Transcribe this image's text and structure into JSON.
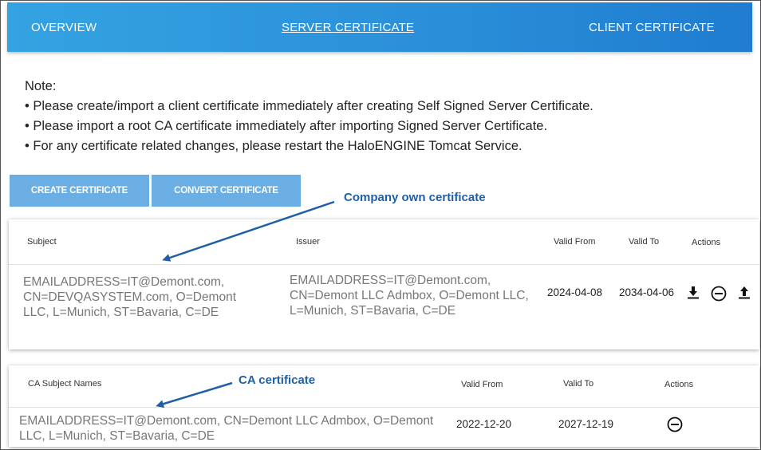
{
  "tabs": {
    "overview": "OVERVIEW",
    "server_certificate": "SERVER CERTIFICATE",
    "client_certificate": "CLIENT CERTIFICATE",
    "active": "server_certificate"
  },
  "note": {
    "heading": "Note:",
    "lines": [
      "• Please create/import a client certificate immediately after creating Self Signed Server Certificate.",
      "• Please import a root CA certificate immediately after importing Signed Server Certificate.",
      "• For any certificate related changes, please restart the HaloENGINE Tomcat Service."
    ]
  },
  "buttons": {
    "create": "CREATE CERTIFICATE",
    "convert": "CONVERT CERTIFICATE"
  },
  "annotations": {
    "company_own": "Company own certificate",
    "ca_certificate": "CA certificate"
  },
  "server_table": {
    "headers": {
      "subject": "Subject",
      "issuer": "Issuer",
      "valid_from": "Valid From",
      "valid_to": "Valid To",
      "actions": "Actions"
    },
    "rows": [
      {
        "subject": "EMAILADDRESS=IT@Demont.com, CN=DEVQASYSTEM.com, O=Demont LLC, L=Munich, ST=Bavaria, C=DE",
        "issuer": "EMAILADDRESS=IT@Demont.com, CN=Demont LLC Admbox, O=Demont LLC, L=Munich, ST=Bavaria, C=DE",
        "valid_from": "2024-04-08",
        "valid_to": "2034-04-06",
        "actions": [
          "download-icon",
          "remove-circle-icon",
          "upload-icon"
        ]
      }
    ]
  },
  "ca_table": {
    "headers": {
      "subject": "CA Subject Names",
      "valid_from": "Valid From",
      "valid_to": "Valid To",
      "actions": "Actions"
    },
    "rows": [
      {
        "subject": "EMAILADDRESS=IT@Demont.com, CN=Demont LLC Admbox, O=Demont LLC, L=Munich, ST=Bavaria, C=DE",
        "valid_from": "2022-12-20",
        "valid_to": "2027-12-19",
        "actions": [
          "remove-circle-icon"
        ]
      }
    ]
  },
  "colors": {
    "topbar": "#2a8ed8",
    "button": "#6aaee3",
    "annotation": "#1f5fa8"
  }
}
